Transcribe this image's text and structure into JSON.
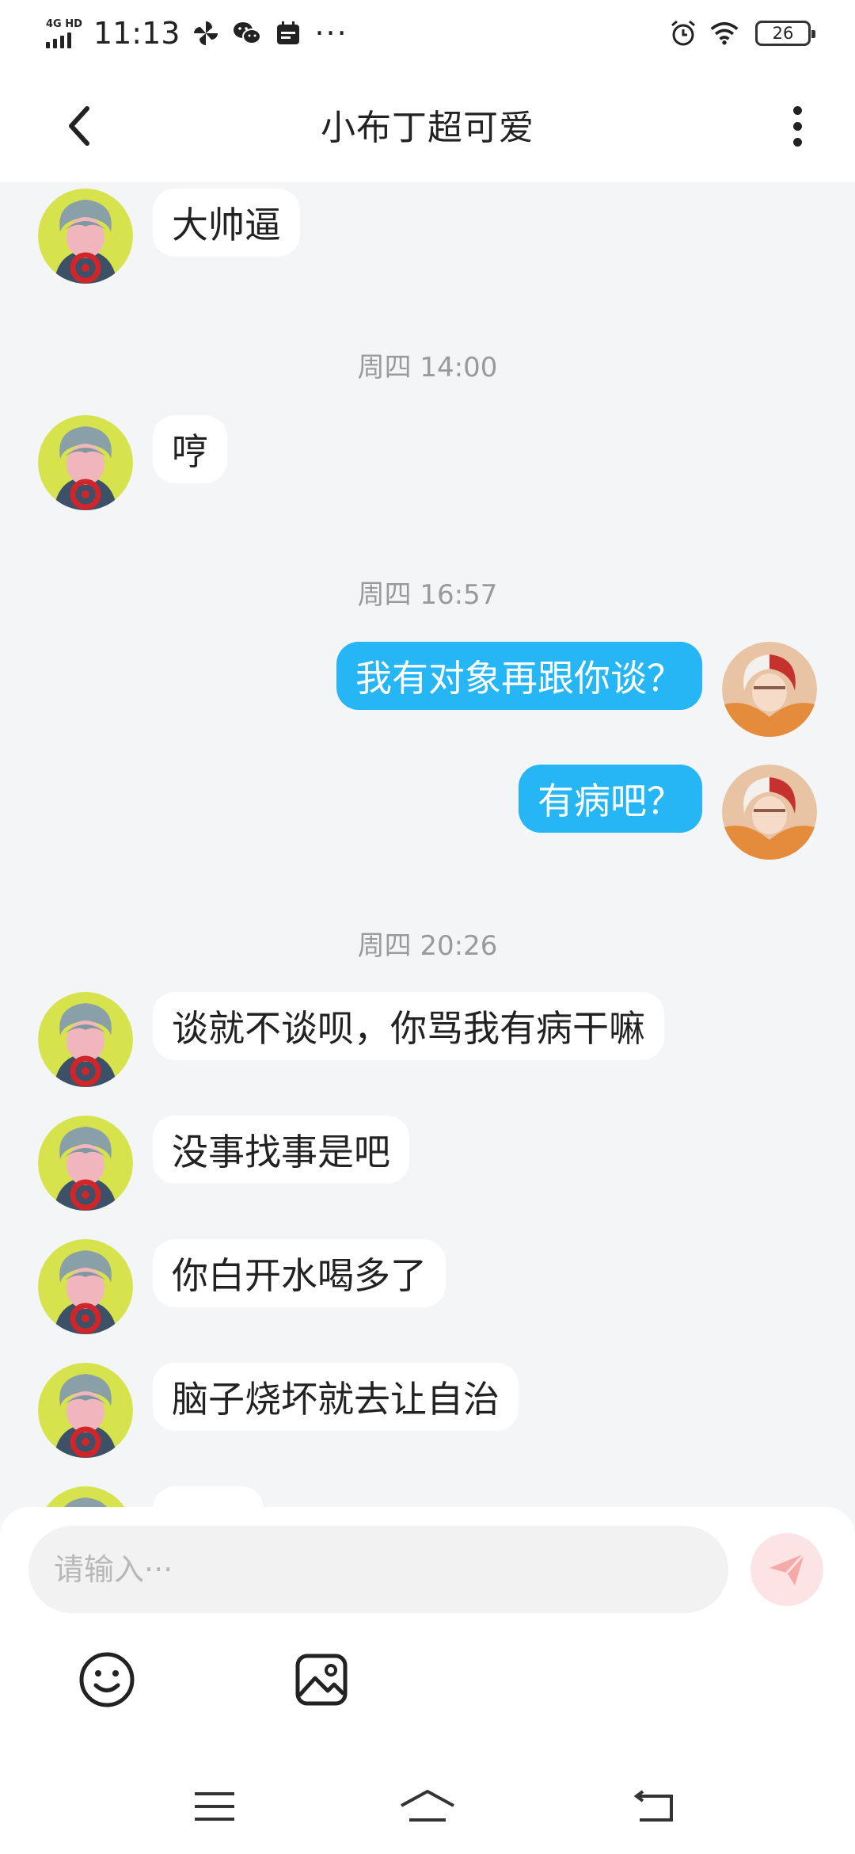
{
  "status_bar": {
    "network_label": "4G HD",
    "time": "11:13",
    "battery_level": "26",
    "overflow_glyph": "···"
  },
  "nav": {
    "title": "小布丁超可爱",
    "back_icon": "chevron-left-icon",
    "more_icon": "more-vertical-icon"
  },
  "messages": [
    {
      "type": "in",
      "text": "大帅逼"
    },
    {
      "type": "time",
      "text": "周四 14:00"
    },
    {
      "type": "in",
      "text": "哼"
    },
    {
      "type": "time",
      "text": "周四 16:57"
    },
    {
      "type": "out",
      "text": "我有对象再跟你谈？"
    },
    {
      "type": "out",
      "text": "有病吧？"
    },
    {
      "type": "time",
      "text": "周四 20:26"
    },
    {
      "type": "in",
      "text": "谈就不谈呗，你骂我有病干嘛"
    },
    {
      "type": "in",
      "text": "没事找事是吧"
    },
    {
      "type": "in",
      "text": "你白开水喝多了"
    },
    {
      "type": "in",
      "text": "脑子烧坏就去让自治"
    }
  ],
  "input": {
    "placeholder": "请输入···",
    "value": ""
  },
  "toolbar": {
    "emoji_icon": "smiley-icon",
    "image_icon": "image-icon",
    "send_icon": "paper-plane-icon"
  },
  "colors": {
    "outgoing_bubble": "#27b6f5",
    "incoming_bubble": "#ffffff",
    "chat_background": "#f4f5f7",
    "send_button_bg": "#fde4e4",
    "send_button_icon": "#f6a9a9"
  }
}
